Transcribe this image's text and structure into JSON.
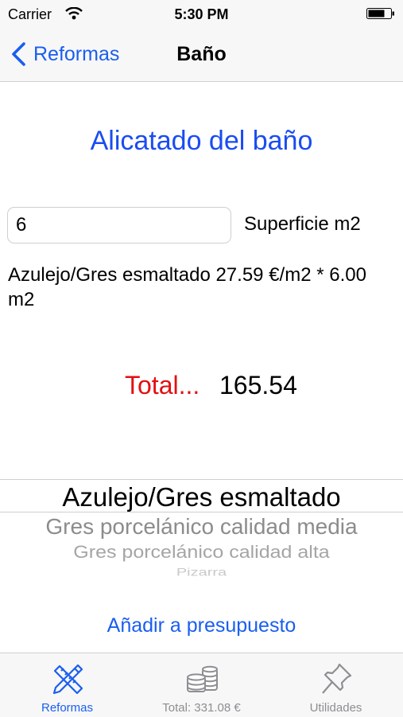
{
  "status": {
    "carrier": "Carrier",
    "time": "5:30 PM"
  },
  "nav": {
    "back_label": "Reformas",
    "title": "Baño"
  },
  "main": {
    "heading": "Alicatado del baño",
    "surface_value": "6",
    "surface_label": "Superficie m2",
    "calc_text": "Azulejo/Gres esmaltado 27.59 €/m2 * 6.00 m2",
    "total_label": "Total...",
    "total_value": "165.54"
  },
  "picker": {
    "items": [
      "Azulejo/Gres esmaltado",
      "Gres porcelánico calidad media",
      "Gres porcelánico calidad alta",
      "Pizarra"
    ],
    "selected": "Azulejo/Gres esmaltado"
  },
  "add_button": "Añadir a presupuesto",
  "tabs": [
    {
      "label": "Reformas",
      "icon": "ruler-pencil-icon",
      "active": true
    },
    {
      "label": "Total: 331.08 €",
      "icon": "coins-icon",
      "active": false
    },
    {
      "label": "Utilidades",
      "icon": "pushpin-icon",
      "active": false
    }
  ],
  "colors": {
    "accent": "#1a5ef0",
    "heading": "#1a4cf2",
    "total": "#e20f12",
    "inactive_tab": "#8e8e93"
  }
}
